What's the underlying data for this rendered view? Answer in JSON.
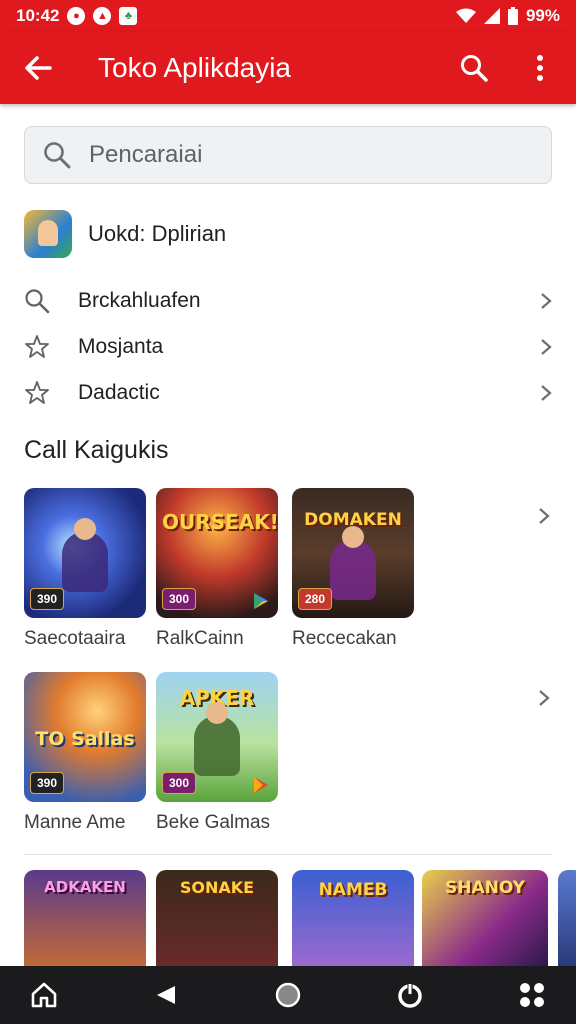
{
  "status_bar": {
    "time": "10:42",
    "battery": "99%"
  },
  "app_bar": {
    "title": "Toko Aplikdayia"
  },
  "search": {
    "placeholder": "Pencaraiai"
  },
  "featured": {
    "label": "Uokd: Dplirian",
    "icon": "game-app-icon"
  },
  "menu": {
    "items": [
      {
        "label": "Brckahluafen",
        "icon": "search-icon"
      },
      {
        "label": "Mosjanta",
        "icon": "star-icon"
      },
      {
        "label": "Dadactic",
        "icon": "star-icon"
      }
    ]
  },
  "section": {
    "title": "Call Kaigukis"
  },
  "apps_row1": [
    {
      "name": "Saecotaaira",
      "art_text": "",
      "badge": "390"
    },
    {
      "name": "RalkCainn",
      "art_text": "OURSEAK!",
      "badge": "300"
    },
    {
      "name": "Reccecakan",
      "art_text": "DOMAKEN",
      "badge": "280"
    }
  ],
  "apps_row2": [
    {
      "name": "Manne Ame",
      "art_text": "TO Sallas",
      "badge": "390"
    },
    {
      "name": "Beke Galmas",
      "art_text": "APKER",
      "badge": "300"
    }
  ],
  "strip": [
    {
      "art_text": "ADKAKEN"
    },
    {
      "art_text": "SONAKE"
    },
    {
      "art_text": "NAMEB"
    },
    {
      "art_text": "SHANOY"
    }
  ],
  "colors": {
    "primary": "#e0191e",
    "navbar": "#1b1b1d"
  }
}
